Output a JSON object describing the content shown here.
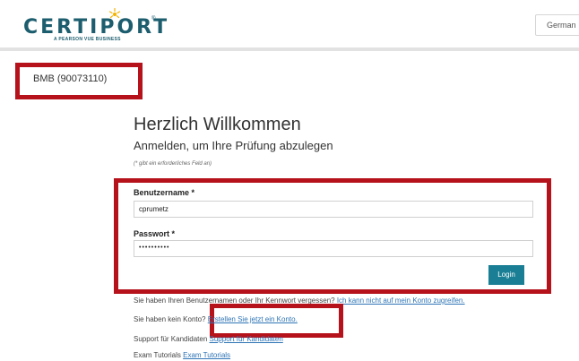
{
  "header": {
    "logo_text": "CERTIPORT",
    "logo_tagline": "A PEARSON VUE BUSINESS",
    "logo_tm": "®",
    "language": "German"
  },
  "org": {
    "code": "BMB (90073110)"
  },
  "login": {
    "title": "Herzlich Willkommen",
    "subtitle": "Anmelden, um Ihre Prüfung abzulegen",
    "required_note": "(* gibt ein erforderliches Feld an)",
    "username_label": "Benutzername *",
    "username_value": "cprumetz",
    "password_label": "Passwort *",
    "password_value": "••••••••••",
    "login_button": "Login"
  },
  "help": {
    "forgot_text": "Sie haben Ihren Benutzernamen oder Ihr Kennwort vergessen?",
    "forgot_link": "Ich kann nicht auf mein Konto zugreifen.",
    "no_account_text": "Sie haben kein Konto?",
    "create_link": "Erstellen Sie jetzt ein Konto.",
    "support_text": "Support für Kandidaten",
    "support_link": "Support für Kandidaten",
    "tutorials_text": "Exam Tutorials",
    "tutorials_link": "Exam Tutorials"
  },
  "colors": {
    "brand": "#1c5d6e",
    "highlight": "#b5121b",
    "button": "#1a7f95",
    "link": "#2e74b5"
  }
}
